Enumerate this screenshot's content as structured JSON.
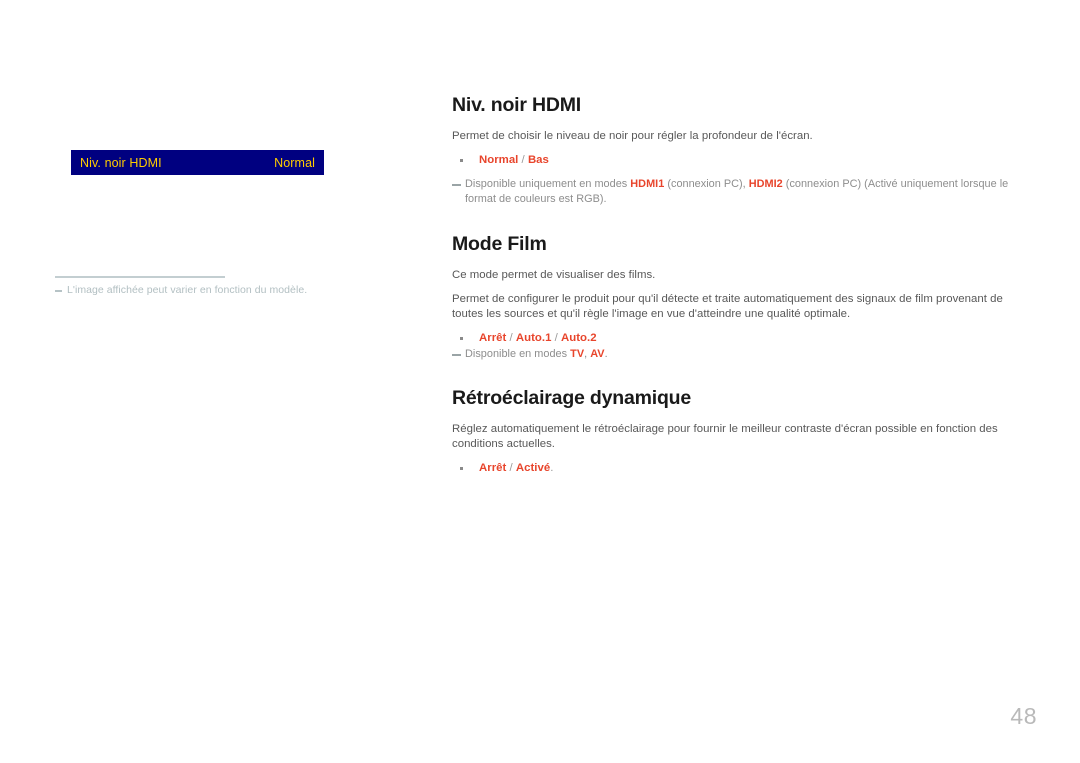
{
  "page": {
    "number": "48"
  },
  "osd_preview": {
    "menu_label": "Niv. noir HDMI",
    "menu_value": "Normal",
    "bar_color": "#000080",
    "text_color": "#ffcc00",
    "footnote": "L'image affichée peut varier en fonction du modèle."
  },
  "sections": [
    {
      "heading": "Niv. noir HDMI",
      "paragraph": "Permet de choisir le niveau de noir pour régler la profondeur de l'écran.",
      "options": {
        "first": "Normal",
        "sep1": " / ",
        "second": "Bas",
        "trailing": ""
      },
      "note": {
        "prefix": "Disponible uniquement en modes ",
        "bold1": "HDMI1",
        "mid1": " (connexion PC), ",
        "bold2": "HDMI2",
        "suffix": " (connexion PC) (Activé uniquement lorsque le format de couleurs est RGB)."
      }
    },
    {
      "heading": "Mode Film",
      "paragraph1": "Ce mode permet de visualiser des films.",
      "paragraph2": "Permet de configurer le produit pour qu'il détecte et traite automatiquement des signaux de film provenant de toutes les sources et qu'il règle l'image en vue d'atteindre une qualité optimale.",
      "options": {
        "first": "Arrêt",
        "sep1": " / ",
        "second": "Auto.1",
        "sep2": " / ",
        "third": "Auto.2"
      },
      "note": {
        "prefix": "Disponible en modes ",
        "bold1": "TV",
        "mid1": ", ",
        "bold2": "AV",
        "suffix": "."
      }
    },
    {
      "heading": "Rétroéclairage dynamique",
      "paragraph": "Réglez automatiquement le rétroéclairage pour fournir le meilleur contraste d'écran possible en fonction des conditions actuelles.",
      "options": {
        "first": "Arrêt",
        "sep1": " / ",
        "second": "Activé",
        "trailing": "."
      }
    }
  ],
  "colors": {
    "accent_red": "#e8452c",
    "heading": "#1a1a1a",
    "body": "#585858",
    "note": "#8d8d8d",
    "osd_blue": "#000080",
    "osd_gold": "#ffcc00",
    "page_number": "#b9b9b9"
  }
}
